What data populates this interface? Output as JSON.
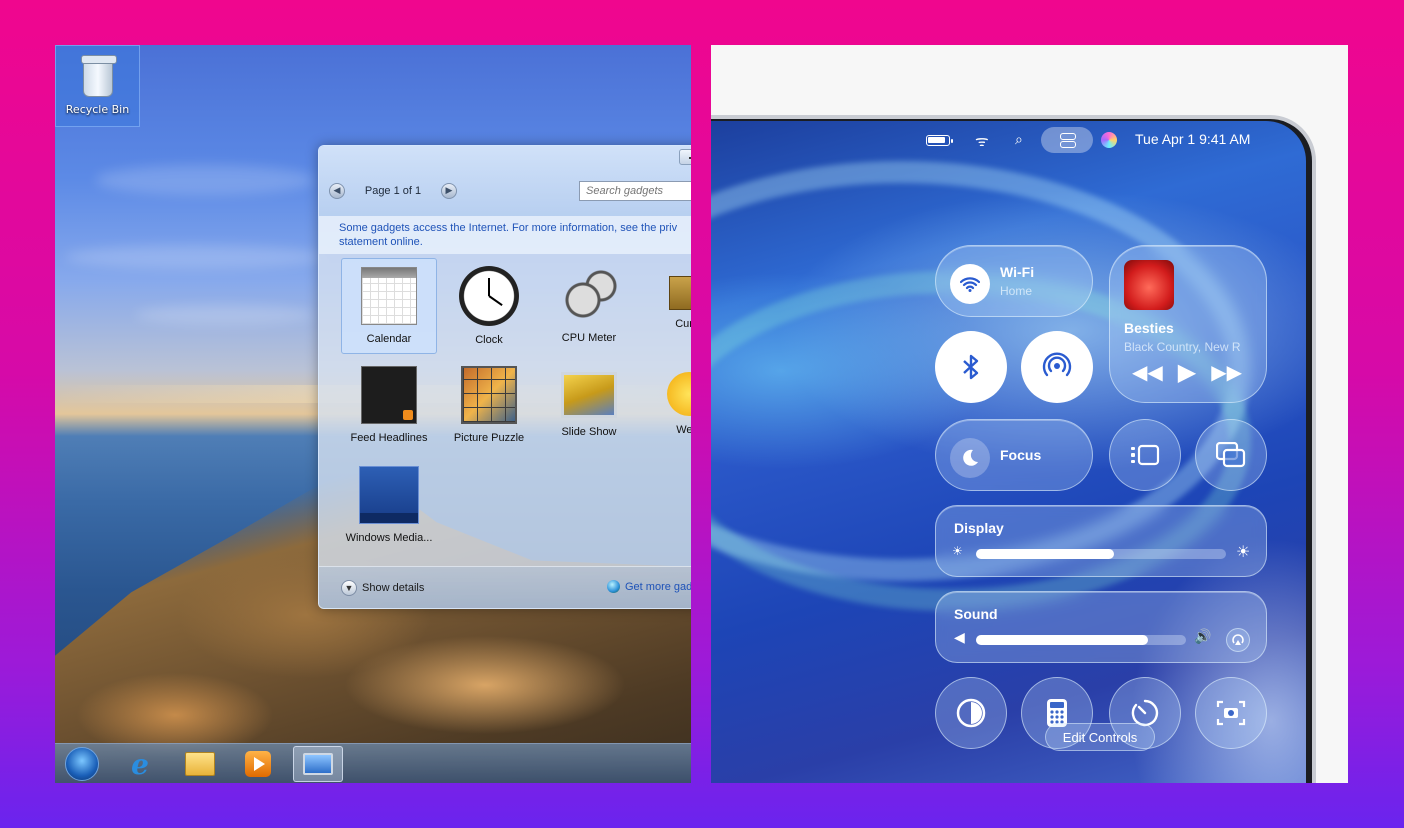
{
  "windows": {
    "desktop_icon": {
      "label": "Recycle Bin"
    },
    "gadget_window": {
      "pager_text": "Page 1 of 1",
      "search_placeholder": "Search gadgets",
      "info_text_line1": "Some gadgets access the Internet.  For more information, see the priv",
      "info_text_line2": "statement online.",
      "gadgets": [
        {
          "name": "Calendar",
          "icon": "calendar-icon",
          "selected": true
        },
        {
          "name": "Clock",
          "icon": "clock-icon"
        },
        {
          "name": "CPU Meter",
          "icon": "cpu-meter-icon"
        },
        {
          "name": "Curre",
          "icon": "currency-icon"
        },
        {
          "name": "Feed Headlines",
          "icon": "feed-icon"
        },
        {
          "name": "Picture Puzzle",
          "icon": "puzzle-icon"
        },
        {
          "name": "Slide Show",
          "icon": "slideshow-icon"
        },
        {
          "name": "Weat",
          "icon": "weather-icon"
        },
        {
          "name": "Windows Media...",
          "icon": "media-center-icon"
        }
      ],
      "show_details": "Show details",
      "get_more": "Get more gadg"
    },
    "taskbar": [
      "start-orb",
      "internet-explorer",
      "file-explorer",
      "media-player",
      "desktop-gadgets"
    ]
  },
  "mac": {
    "menubar": {
      "datetime": "Tue Apr 1  9:41 AM"
    },
    "wifi": {
      "title": "Wi-Fi",
      "subtitle": "Home"
    },
    "now_playing": {
      "title": "Besties",
      "artist": "Black Country, New R"
    },
    "focus": {
      "label": "Focus"
    },
    "display": {
      "label": "Display",
      "level": 0.55
    },
    "sound": {
      "label": "Sound",
      "level": 0.82
    },
    "edit_controls": "Edit Controls"
  },
  "colors": {
    "background_top": "#f0068e",
    "background_bottom": "#6a24ee",
    "gadget_link": "#1f53b8"
  }
}
